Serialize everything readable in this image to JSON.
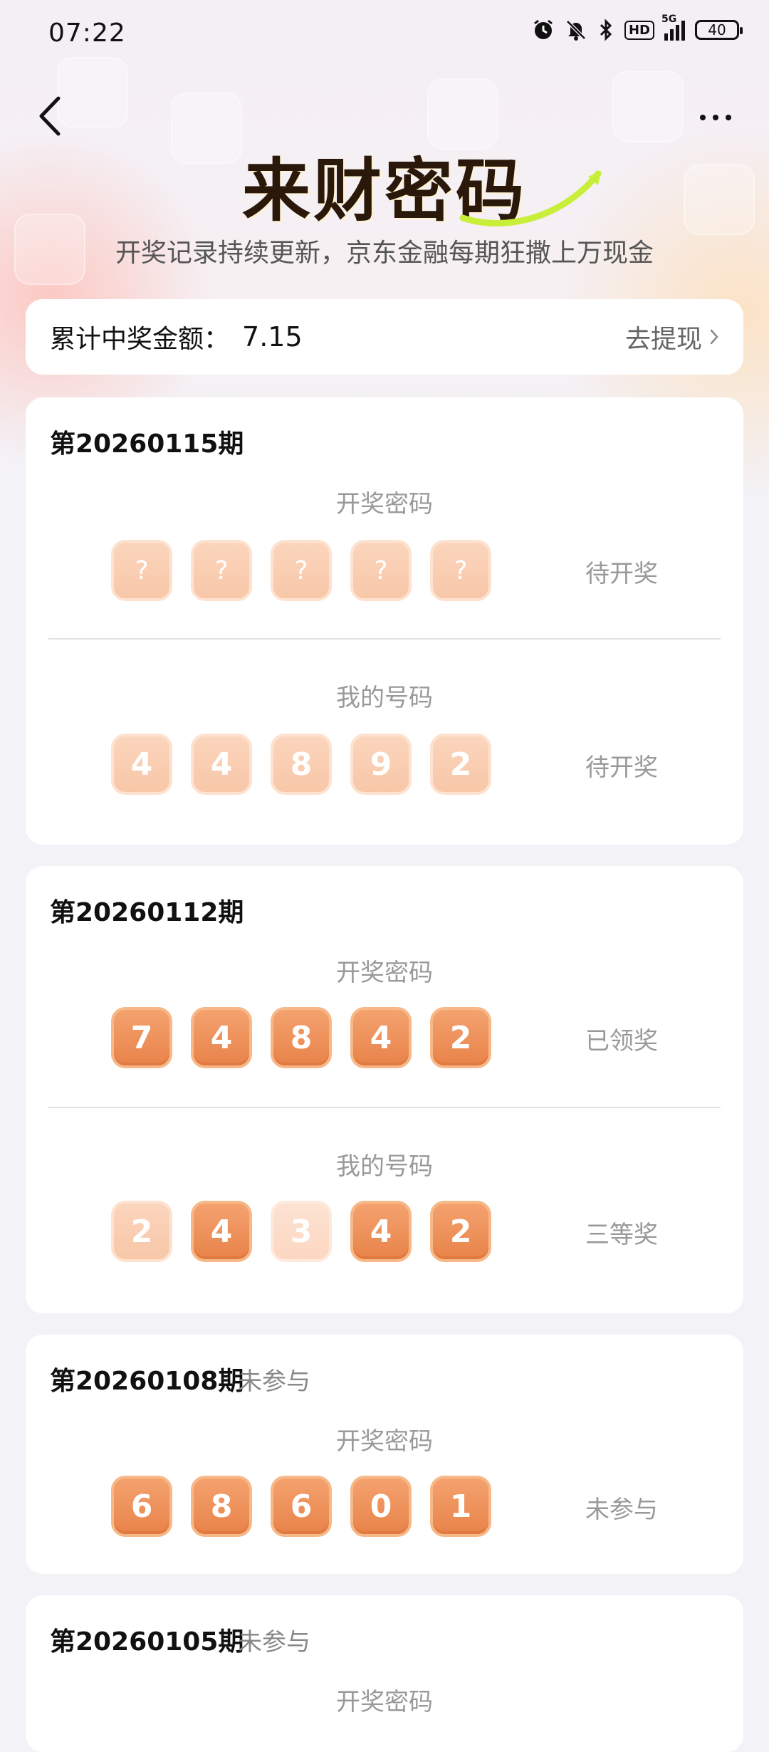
{
  "status_bar": {
    "time": "07:22",
    "network": "5G",
    "hd": "HD",
    "battery": "40"
  },
  "header": {
    "title": "来财密码",
    "subtitle": "开奖记录持续更新，京东金融每期狂撒上万现金",
    "back_icon": "chevron-left-icon",
    "more_icon": "more-horizontal-icon"
  },
  "summary": {
    "label": "累计中奖金额：",
    "amount": "7.15",
    "withdraw_label": "去提现"
  },
  "colors": {
    "ball_strong": "#e8834a",
    "ball_pale": "#f8c7a8",
    "text_muted": "#999999",
    "title": "#2a180a"
  },
  "issues": [
    {
      "title": "第20260115期",
      "tag": "",
      "draw_label": "开奖密码",
      "draw_numbers": [
        "?",
        "?",
        "?",
        "?",
        "?"
      ],
      "draw_status": "待开奖",
      "mine_label": "我的号码",
      "mine_numbers": [
        "4",
        "4",
        "8",
        "9",
        "2"
      ],
      "mine_status": "待开奖"
    },
    {
      "title": "第20260112期",
      "tag": "",
      "draw_label": "开奖密码",
      "draw_numbers": [
        "7",
        "4",
        "8",
        "4",
        "2"
      ],
      "draw_status": "已领奖",
      "mine_label": "我的号码",
      "mine_numbers": [
        "2",
        "4",
        "3",
        "4",
        "2"
      ],
      "mine_status": "三等奖"
    },
    {
      "title": "第20260108期",
      "tag": "未参与",
      "draw_label": "开奖密码",
      "draw_numbers": [
        "6",
        "8",
        "6",
        "0",
        "1"
      ],
      "draw_status": "未参与"
    },
    {
      "title": "第20260105期",
      "tag": "未参与",
      "draw_label": "开奖密码"
    }
  ]
}
